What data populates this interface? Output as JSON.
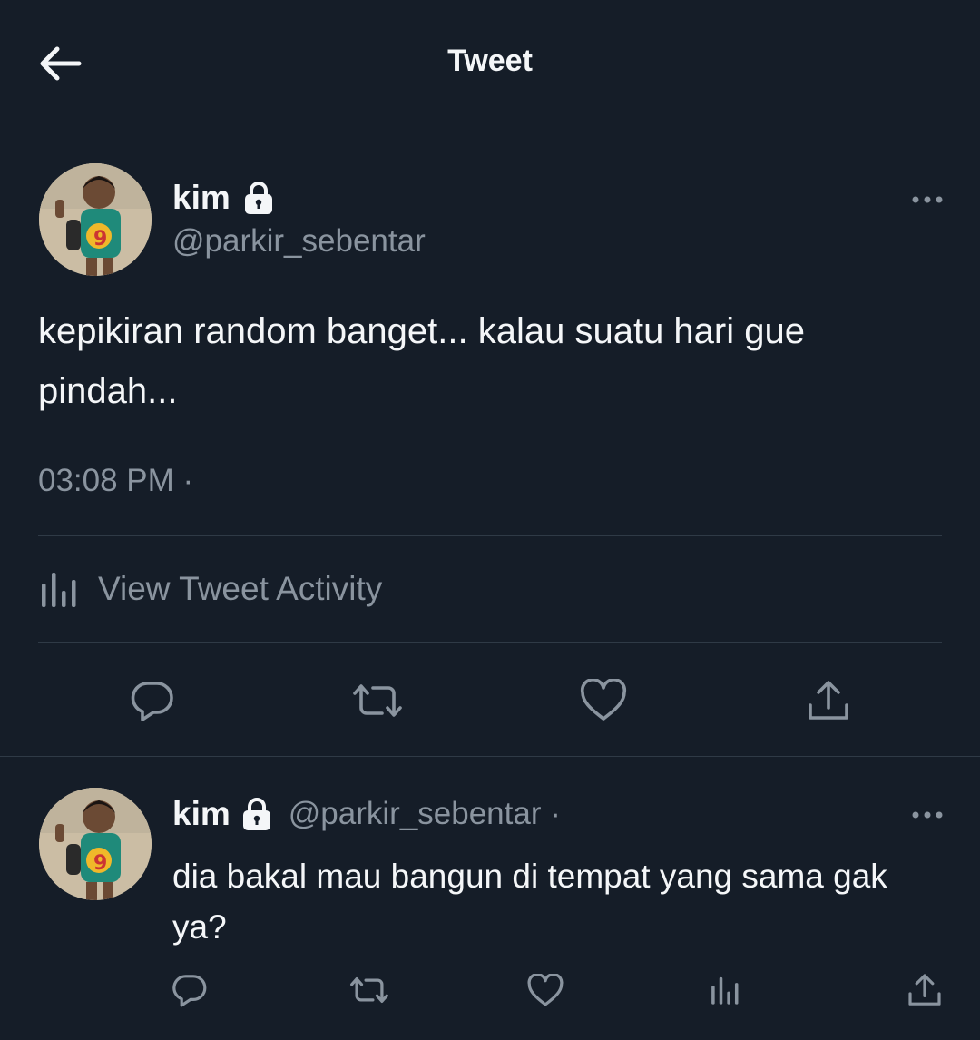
{
  "header": {
    "title": "Tweet",
    "back_icon": "arrow-left-icon"
  },
  "main_tweet": {
    "author_name": "kim",
    "author_handle": "@parkir_sebentar",
    "text": "kepikiran random banget... kalau suatu hari gue pindah...",
    "timestamp": "03:08 PM ·",
    "activity_label": "View Tweet Activity"
  },
  "reply_tweet": {
    "author_name": "kim",
    "author_handle": "@parkir_sebentar ·",
    "text": "dia bakal mau bangun di tempat yang sama gak ya?"
  },
  "colors": {
    "background": "#151d28",
    "text_primary": "#f4f6f8",
    "text_secondary": "#8a949f",
    "divider": "#2f3a46"
  }
}
